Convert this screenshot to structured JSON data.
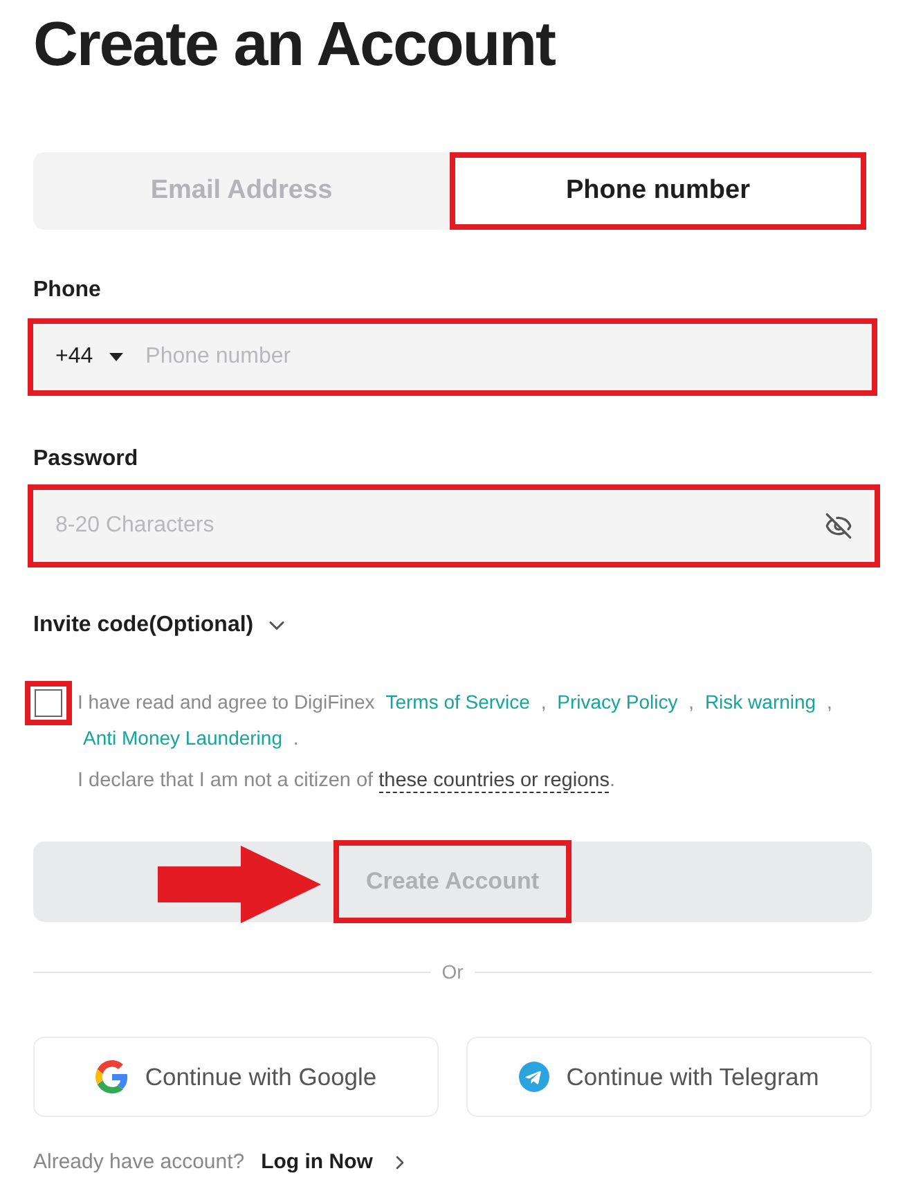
{
  "title": "Create an Account",
  "tabs": [
    {
      "label": "Email Address",
      "selected": false,
      "highlighted": false
    },
    {
      "label": "Phone number",
      "selected": true,
      "highlighted": true
    }
  ],
  "phone": {
    "label": "Phone",
    "country_code": "+44",
    "placeholder": "Phone number",
    "highlighted": true
  },
  "password": {
    "label": "Password",
    "placeholder": "8-20 Characters",
    "highlighted": true
  },
  "invite_code": {
    "label": "Invite code(Optional)",
    "expanded": false
  },
  "agreement": {
    "checked": false,
    "highlighted": true,
    "parts": [
      {
        "kind": "text",
        "text": "I have read and agree to DigiFinex"
      },
      {
        "kind": "link",
        "text": "Terms of Service"
      },
      {
        "kind": "text",
        "text": ","
      },
      {
        "kind": "link",
        "text": "Privacy Policy"
      },
      {
        "kind": "text",
        "text": ","
      },
      {
        "kind": "link",
        "text": "Risk warning"
      },
      {
        "kind": "text",
        "text": ","
      },
      {
        "kind": "link",
        "text": "Anti Money Laundering"
      },
      {
        "kind": "text",
        "text": "."
      }
    ]
  },
  "declaration": {
    "text": "I declare that I am not a citizen of",
    "link": "these countries or regions",
    "end": "."
  },
  "create_button": {
    "label": "Create Account",
    "disabled": true,
    "highlighted": true,
    "arrow": true
  },
  "divider": "Or",
  "social": [
    {
      "kind": "google",
      "label": "Continue with Google"
    },
    {
      "kind": "telegram",
      "label": "Continue with Telegram"
    }
  ],
  "footer": {
    "text": "Already have account?",
    "link": "Log in Now"
  }
}
